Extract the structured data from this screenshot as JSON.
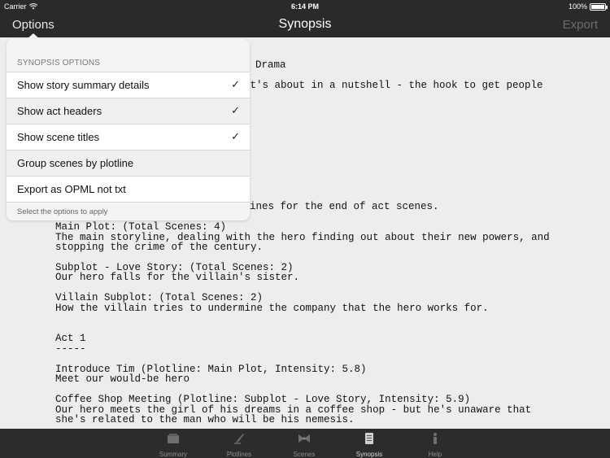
{
  "status_bar": {
    "carrier": "Carrier",
    "time": "6:14 PM",
    "battery": "100%"
  },
  "nav": {
    "options_label": "Options",
    "title": "Synopsis",
    "export_label": "Export"
  },
  "document": {
    "lines": [
      "Drama",
      "it's about in a nutshell - the hook to get people",
      "ines for the end of act scenes.",
      "Main Plot: (Total Scenes: 4)",
      "The main storyline, dealing with the hero finding out about their new powers, and",
      "stopping the crime of the century.",
      "Subplot - Love Story: (Total Scenes: 2)",
      "Our hero falls for the villain's sister.",
      "Villain Subplot: (Total Scenes: 2)",
      "How the villain tries to undermine the company that the hero works for.",
      "Act 1",
      "-----",
      "Introduce Tim (Plotline: Main Plot, Intensity: 5.8)",
      "Meet our would-be hero",
      "Coffee Shop Meeting (Plotline: Subplot - Love Story, Intensity: 5.9)",
      "Our hero meets the girl of his dreams in a coffee shop - but he's unaware that",
      "she's related to the man who will be his nemesis."
    ]
  },
  "popover": {
    "header": "SYNOPSIS OPTIONS",
    "options": [
      {
        "label": "Show story summary details",
        "checked": true
      },
      {
        "label": "Show act headers",
        "checked": true
      },
      {
        "label": "Show scene titles",
        "checked": true
      },
      {
        "label": "Group scenes by plotline",
        "checked": false
      },
      {
        "label": "Export as OPML not txt",
        "checked": false
      }
    ],
    "check_glyph": "✓",
    "footer": "Select the options to apply"
  },
  "tabbar": {
    "tabs": [
      {
        "label": "Summary",
        "icon": "summary-icon",
        "active": false
      },
      {
        "label": "Plotlines",
        "icon": "plotlines-icon",
        "active": false
      },
      {
        "label": "Scenes",
        "icon": "scenes-icon",
        "active": false
      },
      {
        "label": "Synopsis",
        "icon": "synopsis-icon",
        "active": true
      },
      {
        "label": "Help",
        "icon": "help-icon",
        "active": false
      }
    ]
  }
}
